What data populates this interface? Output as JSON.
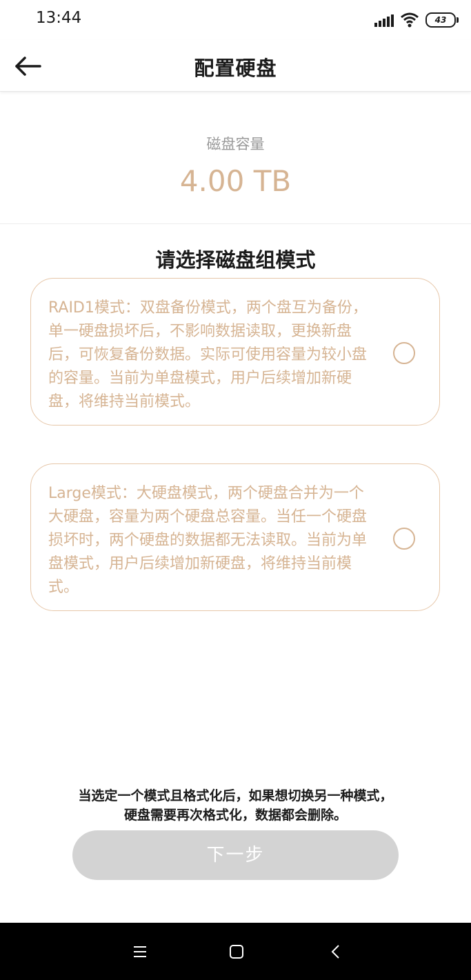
{
  "status_bar": {
    "time": "13:44",
    "battery_level": "43",
    "icons": [
      "signal-icon",
      "wifi-icon",
      "battery-icon"
    ]
  },
  "header": {
    "title": "配置硬盘",
    "back_icon": "arrow-left-icon"
  },
  "capacity": {
    "label": "磁盘容量",
    "value": "4.00 TB"
  },
  "section": {
    "title": "请选择磁盘组模式"
  },
  "options": [
    {
      "text": "RAID1模式：双盘备份模式，两个盘互为备份，单一硬盘损坏后，不影响数据读取，更换新盘后，可恢复备份数据。实际可使用容量为较小盘的容量。当前为单盘模式，用户后续增加新硬盘，将维持当前模式。",
      "selected": false
    },
    {
      "text": "Large模式：大硬盘模式，两个硬盘合并为一个大硬盘，容量为两个硬盘总容量。当任一个硬盘损坏时，两个硬盘的数据都无法读取。当前为单盘模式，用户后续增加新硬盘，将维持当前模式。",
      "selected": false
    }
  ],
  "footer": {
    "note_line1": "当选定一个模式且格式化后，如果想切换另一种模式，",
    "note_line2": "硬盘需要再次格式化，数据都会删除。",
    "next_button": "下一步"
  },
  "nav_bar": {
    "icons": [
      "menu-icon",
      "home-icon",
      "back-icon"
    ]
  },
  "colors": {
    "accent": "#d6b493",
    "card_border": "#e6c6a8",
    "button_disabled": "#d3d3d3",
    "text_primary": "#1a1a1a",
    "text_secondary": "#999999"
  }
}
